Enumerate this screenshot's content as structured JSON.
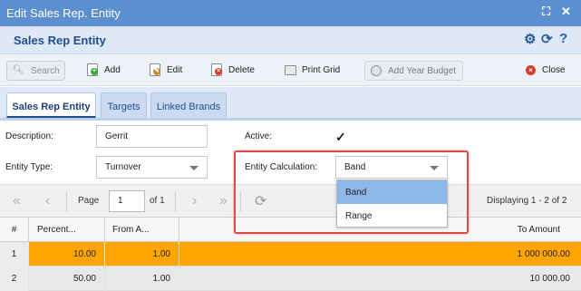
{
  "window": {
    "title": "Edit Sales Rep. Entity",
    "controls": [
      "⛶",
      "✕"
    ]
  },
  "header": {
    "title": "Sales Rep Entity",
    "icons": [
      "gear-icon",
      "refresh-icon",
      "help-icon"
    ]
  },
  "toolbar": {
    "search_label": "Search",
    "add_label": "Add",
    "edit_label": "Edit",
    "delete_label": "Delete",
    "print_label": "Print Grid",
    "add_year_budget_label": "Add Year Budget",
    "close_label": "Close"
  },
  "tabs": [
    {
      "label": "Sales Rep Entity",
      "active": true
    },
    {
      "label": "Targets",
      "active": false
    },
    {
      "label": "Linked Brands",
      "active": false
    }
  ],
  "form": {
    "description_label": "Description:",
    "description_value": "Gerrit",
    "active_label": "Active:",
    "active_checked": true,
    "entity_type_label": "Entity Type:",
    "entity_type_value": "Turnover",
    "entity_calc_label": "Entity Calculation:",
    "entity_calc_value": "Band",
    "entity_calc_options": [
      {
        "label": "Band",
        "selected": true
      },
      {
        "label": "Range",
        "selected": false
      }
    ]
  },
  "pager": {
    "page_label": "Page",
    "page_value": "1",
    "of_label": "of 1",
    "displaying": "Displaying 1 - 2 of 2"
  },
  "grid": {
    "columns": [
      "#",
      "Percent...",
      "From A...",
      "To Amount"
    ],
    "rows": [
      {
        "num": "1",
        "percent": "10.00",
        "from": "1.00",
        "to": "1 000 000.00",
        "selected": true
      },
      {
        "num": "2",
        "percent": "50.00",
        "from": "1.00",
        "to": "10 000.00",
        "selected": false
      }
    ]
  },
  "colors": {
    "titlebar": "#5b8fd0",
    "selected_row": "#ffa500",
    "highlight": "#e04848",
    "dropdown_active": "#8fb8ea"
  }
}
